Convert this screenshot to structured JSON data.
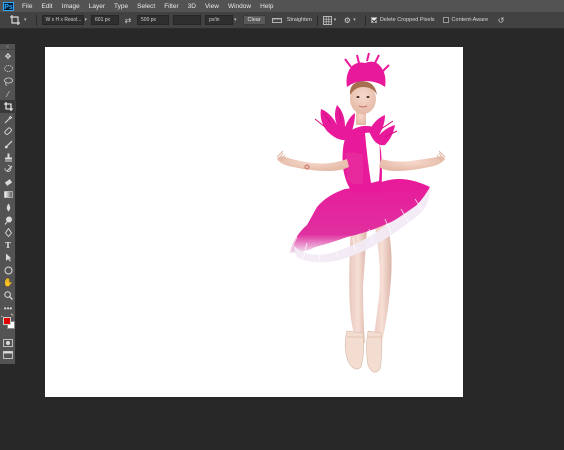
{
  "app": {
    "logo_text": "Ps"
  },
  "menu": [
    "File",
    "Edit",
    "Image",
    "Layer",
    "Type",
    "Select",
    "Filter",
    "3D",
    "View",
    "Window",
    "Help"
  ],
  "options_bar": {
    "ratio_select": "W x H x Resol...",
    "width_value": "601 px",
    "height_value": "500 px",
    "resolution_value": "",
    "resolution_unit": "px/in",
    "clear_label": "Clear",
    "straighten_label": "Straighten",
    "delete_cropped_label": "Delete Cropped Pixels",
    "delete_cropped_checked": true,
    "content_aware_label": "Content-Aware",
    "content_aware_checked": false
  },
  "colors": {
    "foreground": "#e00000",
    "background": "#ffffff",
    "tutu_pink": "#e8199a"
  }
}
